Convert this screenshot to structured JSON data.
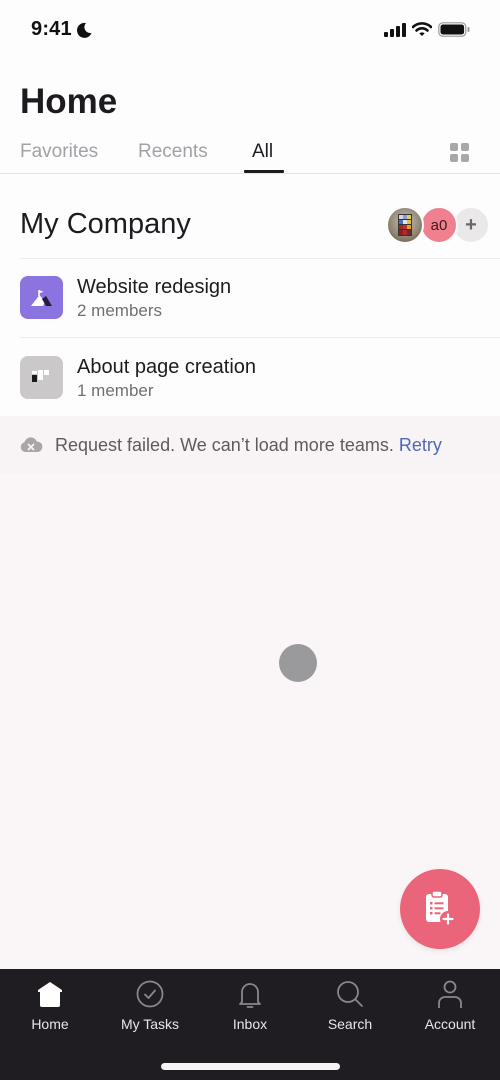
{
  "status_bar": {
    "time": "9:41",
    "icons": [
      "moon-icon",
      "cellular-signal-icon",
      "wifi-icon",
      "battery-icon"
    ]
  },
  "header": {
    "title": "Home",
    "tabs": [
      {
        "label": "Favorites",
        "active": false
      },
      {
        "label": "Recents",
        "active": false
      },
      {
        "label": "All",
        "active": true
      }
    ],
    "view_toggle_icon": "grid-icon"
  },
  "company": {
    "name": "My Company",
    "members": [
      {
        "type": "photo",
        "icon": "rubiks-cube-photo"
      },
      {
        "type": "initials",
        "initials": "a0"
      },
      {
        "type": "add",
        "label": "+"
      }
    ],
    "teams": [
      {
        "name": "Website redesign",
        "members": "2 members",
        "icon": "mountain-flag-icon",
        "color": "#8b73e0"
      },
      {
        "name": "About page creation",
        "members": "1 member",
        "icon": "blocks-icon",
        "color": "#cbc8ca"
      }
    ]
  },
  "error": {
    "icon": "cloud-error-icon",
    "title": "Request failed.",
    "message": " We can’t load more teams. ",
    "action": "Retry"
  },
  "fab": {
    "icon": "clipboard-add-icon",
    "color": "#ea6579"
  },
  "bottom_nav": {
    "items": [
      {
        "label": "Home",
        "icon": "home-icon",
        "active": true
      },
      {
        "label": "My Tasks",
        "icon": "check-circle-icon",
        "active": false
      },
      {
        "label": "Inbox",
        "icon": "bell-icon",
        "active": false
      },
      {
        "label": "Search",
        "icon": "search-icon",
        "active": false
      },
      {
        "label": "Account",
        "icon": "person-icon",
        "active": false
      }
    ]
  }
}
